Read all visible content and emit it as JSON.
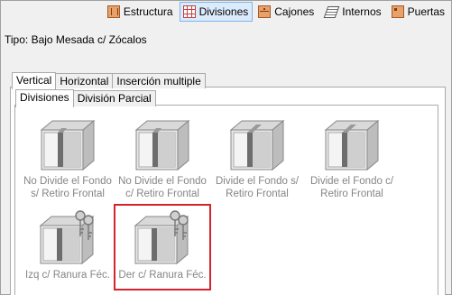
{
  "toolbar": {
    "items": [
      {
        "label": "Estructura",
        "icon": "estructura-icon",
        "active": false
      },
      {
        "label": "Divisiones",
        "icon": "divisiones-icon",
        "active": true
      },
      {
        "label": "Cajones",
        "icon": "cajones-icon",
        "active": false
      },
      {
        "label": "Internos",
        "icon": "internos-icon",
        "active": false
      },
      {
        "label": "Puertas",
        "icon": "puertas-icon",
        "active": false
      }
    ]
  },
  "tipo": "Tipo: Bajo Mesada c/ Zócalos",
  "outer_tabs": [
    "Vertical",
    "Horizontal",
    "Inserción multiple"
  ],
  "inner_tabs": [
    "Divisiones",
    "División Parcial"
  ],
  "items": [
    {
      "line1": "No Divide el Fondo",
      "line2": "s/ Retiro Frontal",
      "icon": "cabinet-divider-icon",
      "keys": false,
      "selected": false
    },
    {
      "line1": "No Divide el Fondo",
      "line2": "c/ Retiro Frontal",
      "icon": "cabinet-divider-icon",
      "keys": false,
      "selected": false
    },
    {
      "line1": "Divide el Fondo s/",
      "line2": "Retiro Frontal",
      "icon": "cabinet-divider-icon",
      "keys": false,
      "selected": false
    },
    {
      "line1": "Divide el Fondo c/",
      "line2": "Retiro Frontal",
      "icon": "cabinet-divider-icon",
      "keys": false,
      "selected": false
    },
    {
      "line1": "Izq c/ Ranura Féc.",
      "line2": "",
      "icon": "cabinet-keys-icon",
      "keys": true,
      "selected": false
    },
    {
      "line1": "Der c/ Ranura Féc.",
      "line2": "",
      "icon": "cabinet-keys-icon",
      "keys": true,
      "selected": true
    }
  ],
  "colors": {
    "selection": "#d6232a",
    "active_tab_bg": "#dcebfc"
  }
}
